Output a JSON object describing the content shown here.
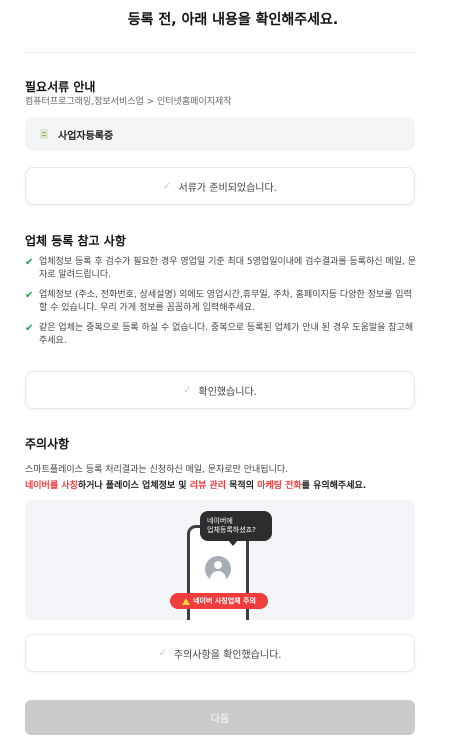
{
  "header": {
    "title": "등록 전, 아래 내용을 확인해주세요."
  },
  "required_docs": {
    "title": "필요서류 안내",
    "category": "컴퓨터프로그래밍,정보서비스업 > 인터넷홈페이지제작",
    "document": "사업자등록증",
    "confirm_label": "서류가 준비되었습니다."
  },
  "reference": {
    "title": "업체 등록 참고 사항",
    "notes": [
      "업체정보 등록 후 검수가 필요한 경우 영업일 기준 최대 5영업일이내에 검수결과를 등록하신 메일, 문자로 알려드립니다.",
      "업체정보 (주소, 전화번호, 상세설명) 외에도 영업시간,휴무일, 주차, 홈페이지등 다양한 정보를 입력할 수 있습니다. 우리 가게 정보를 꼼꼼하게 입력해주세요.",
      "같은 업체는 중복으로 등록 하실 수 없습니다. 중복으로 등록된 업체가 안내 된 경우 도움말을 참고해주세요."
    ],
    "confirm_label": "확인했습니다."
  },
  "caution": {
    "title": "주의사항",
    "line1": "스마트플레이스 등록 처리결과는 신청하신 메일, 문자로만 안내됩니다.",
    "line2_parts": [
      "네이버를 사칭",
      "하거나 플레이스 업체정보 및 ",
      "리뷰 관리",
      " 목적의 ",
      "마케팅 전화",
      "를 유의해주세요."
    ],
    "bubble_line1": "네이버에",
    "bubble_line2": "업체등록하셨죠?",
    "badge": "네이버 사칭업체 주의",
    "confirm_label": "주의사항을 확인했습니다."
  },
  "footer": {
    "next_label": "다음"
  },
  "icons": {
    "check": "check-icon",
    "document": "document-icon",
    "warning": "warning-icon",
    "avatar": "user-avatar-icon"
  },
  "colors": {
    "check_green": "#17a34a",
    "warning_red": "#ef3d3d",
    "disabled_button": "#cbcbcb"
  }
}
